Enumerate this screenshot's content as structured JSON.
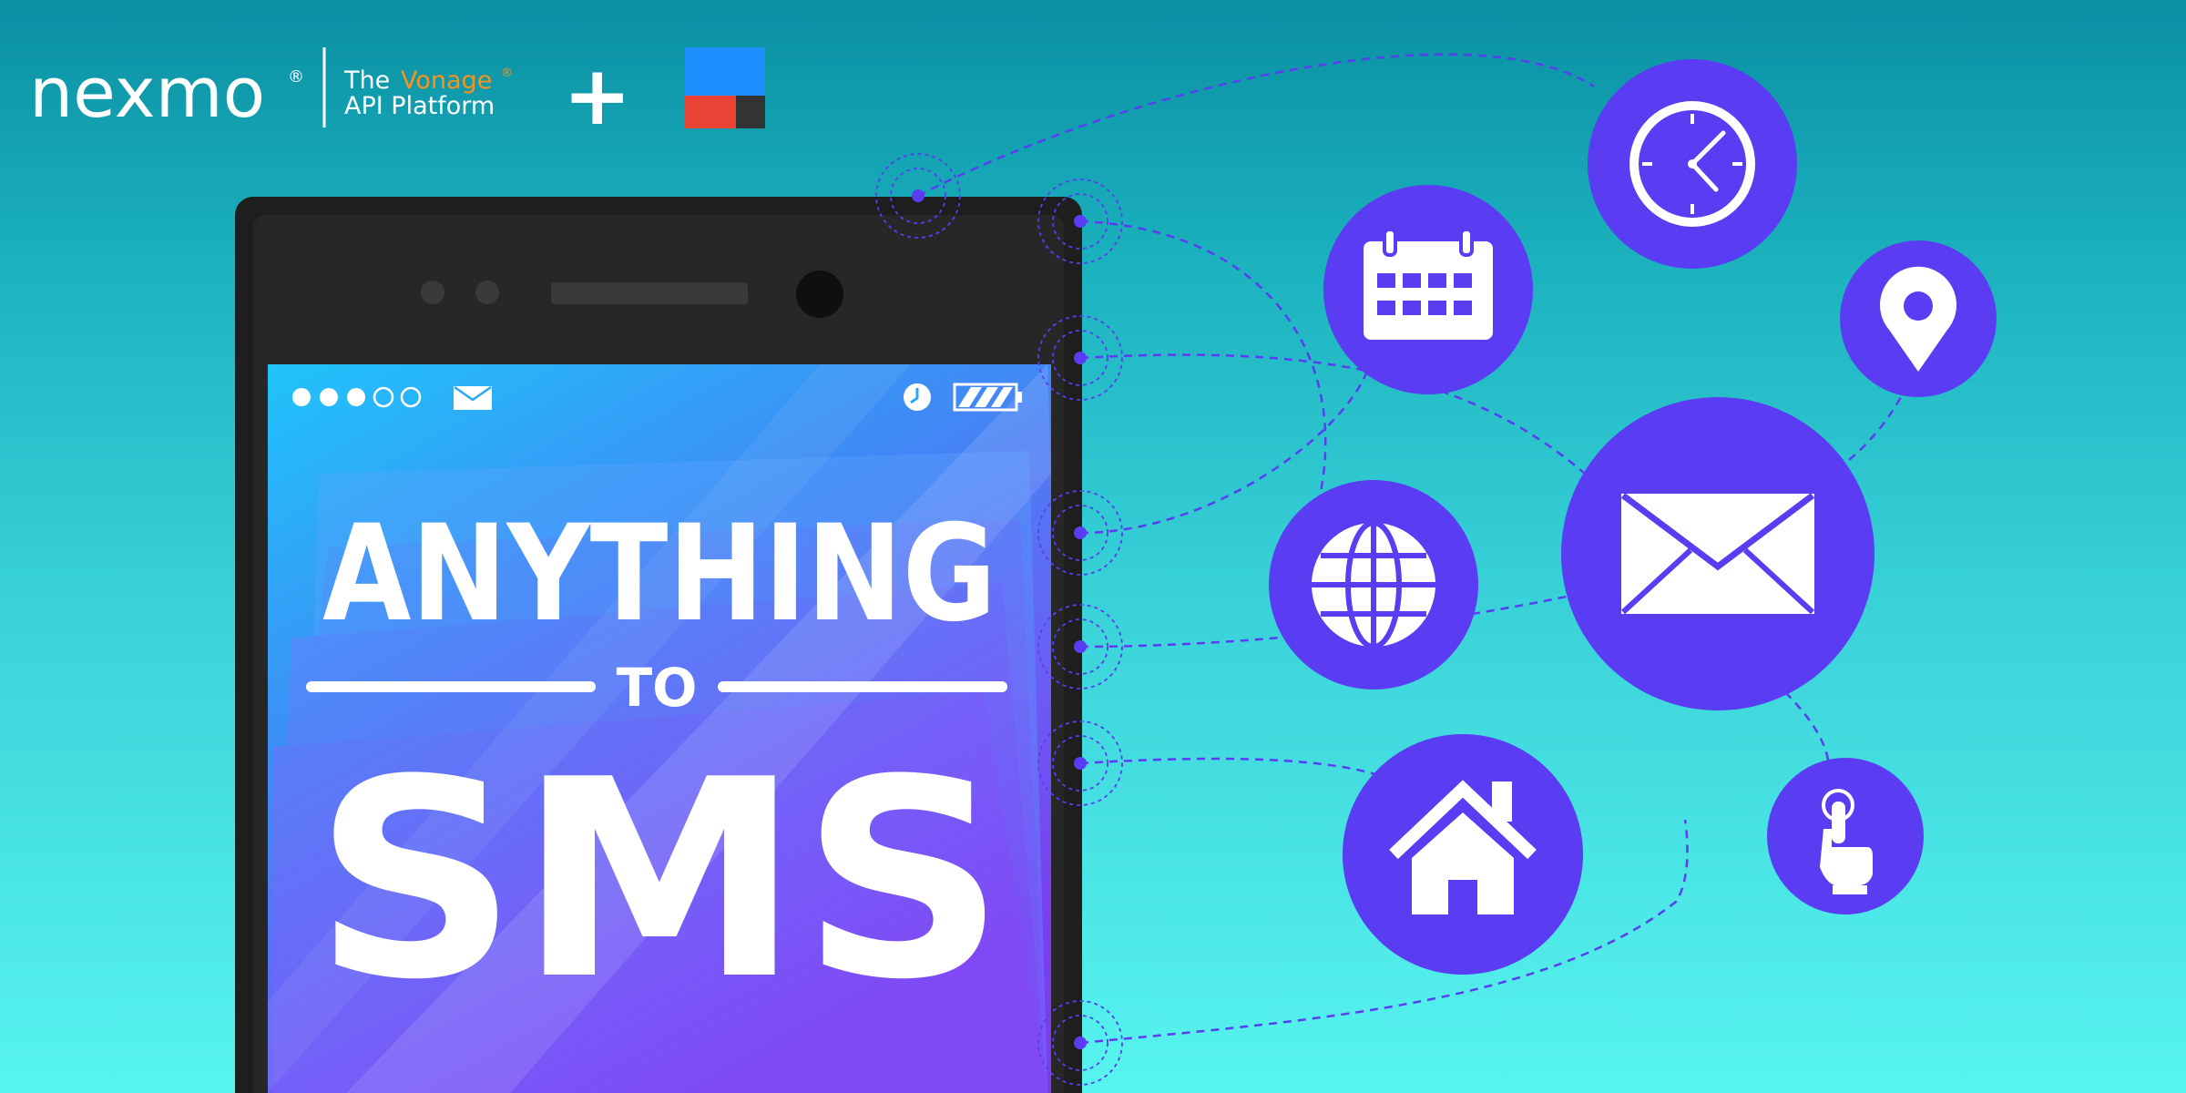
{
  "header": {
    "brand_name": "nexmo",
    "brand_registered": "®",
    "tagline_the": "The",
    "tagline_vonage": "Vonage",
    "tagline_vonage_reg": "®",
    "tagline_platform": "API Platform",
    "plus_symbol": "+"
  },
  "phone": {
    "status_bar": {
      "signal_dots_filled": 3,
      "signal_dots_total": 5,
      "icons": [
        "mail-icon",
        "clock-icon",
        "battery-icon"
      ]
    },
    "screen": {
      "headline_top": "ANYTHING",
      "headline_mid": "TO",
      "headline_bottom": "SMS"
    }
  },
  "feature_icons": [
    "clock-icon",
    "calendar-icon",
    "location-pin-icon",
    "envelope-icon",
    "globe-icon",
    "home-icon",
    "touch-hand-icon"
  ],
  "colors": {
    "accent_purple": "#5a3cf2",
    "vonage_orange": "#f7941d",
    "phone_body": "#1e1e1e",
    "logo_blue": "#1f8fff",
    "logo_red": "#ea4335",
    "logo_dark": "#333333"
  }
}
